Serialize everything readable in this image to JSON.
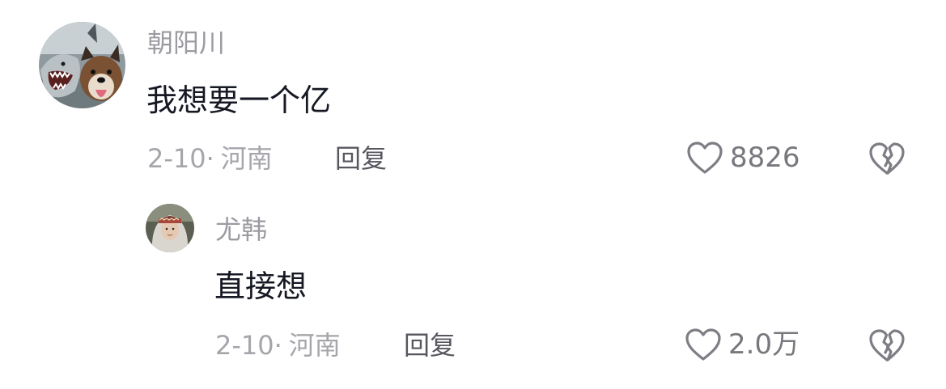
{
  "comments": [
    {
      "username": "朝阳川",
      "text": "我想要一个亿",
      "date": "2-10",
      "separator": "·",
      "location": "河南",
      "reply_label": "回复",
      "likes": "8826",
      "avatar_icon": "shark-and-dog-avatar"
    },
    {
      "username": "尤韩",
      "text": "直接想",
      "date": "2-10",
      "separator": "·",
      "location": "河南",
      "reply_label": "回复",
      "likes": "2.0万",
      "avatar_icon": "person-avatar"
    }
  ],
  "colors": {
    "background": "#ffffff",
    "username": "#9b9ba1",
    "content": "#161823",
    "meta": "#a5a5ab",
    "reply": "#57575f",
    "icon_stroke": "#7d7d84"
  }
}
